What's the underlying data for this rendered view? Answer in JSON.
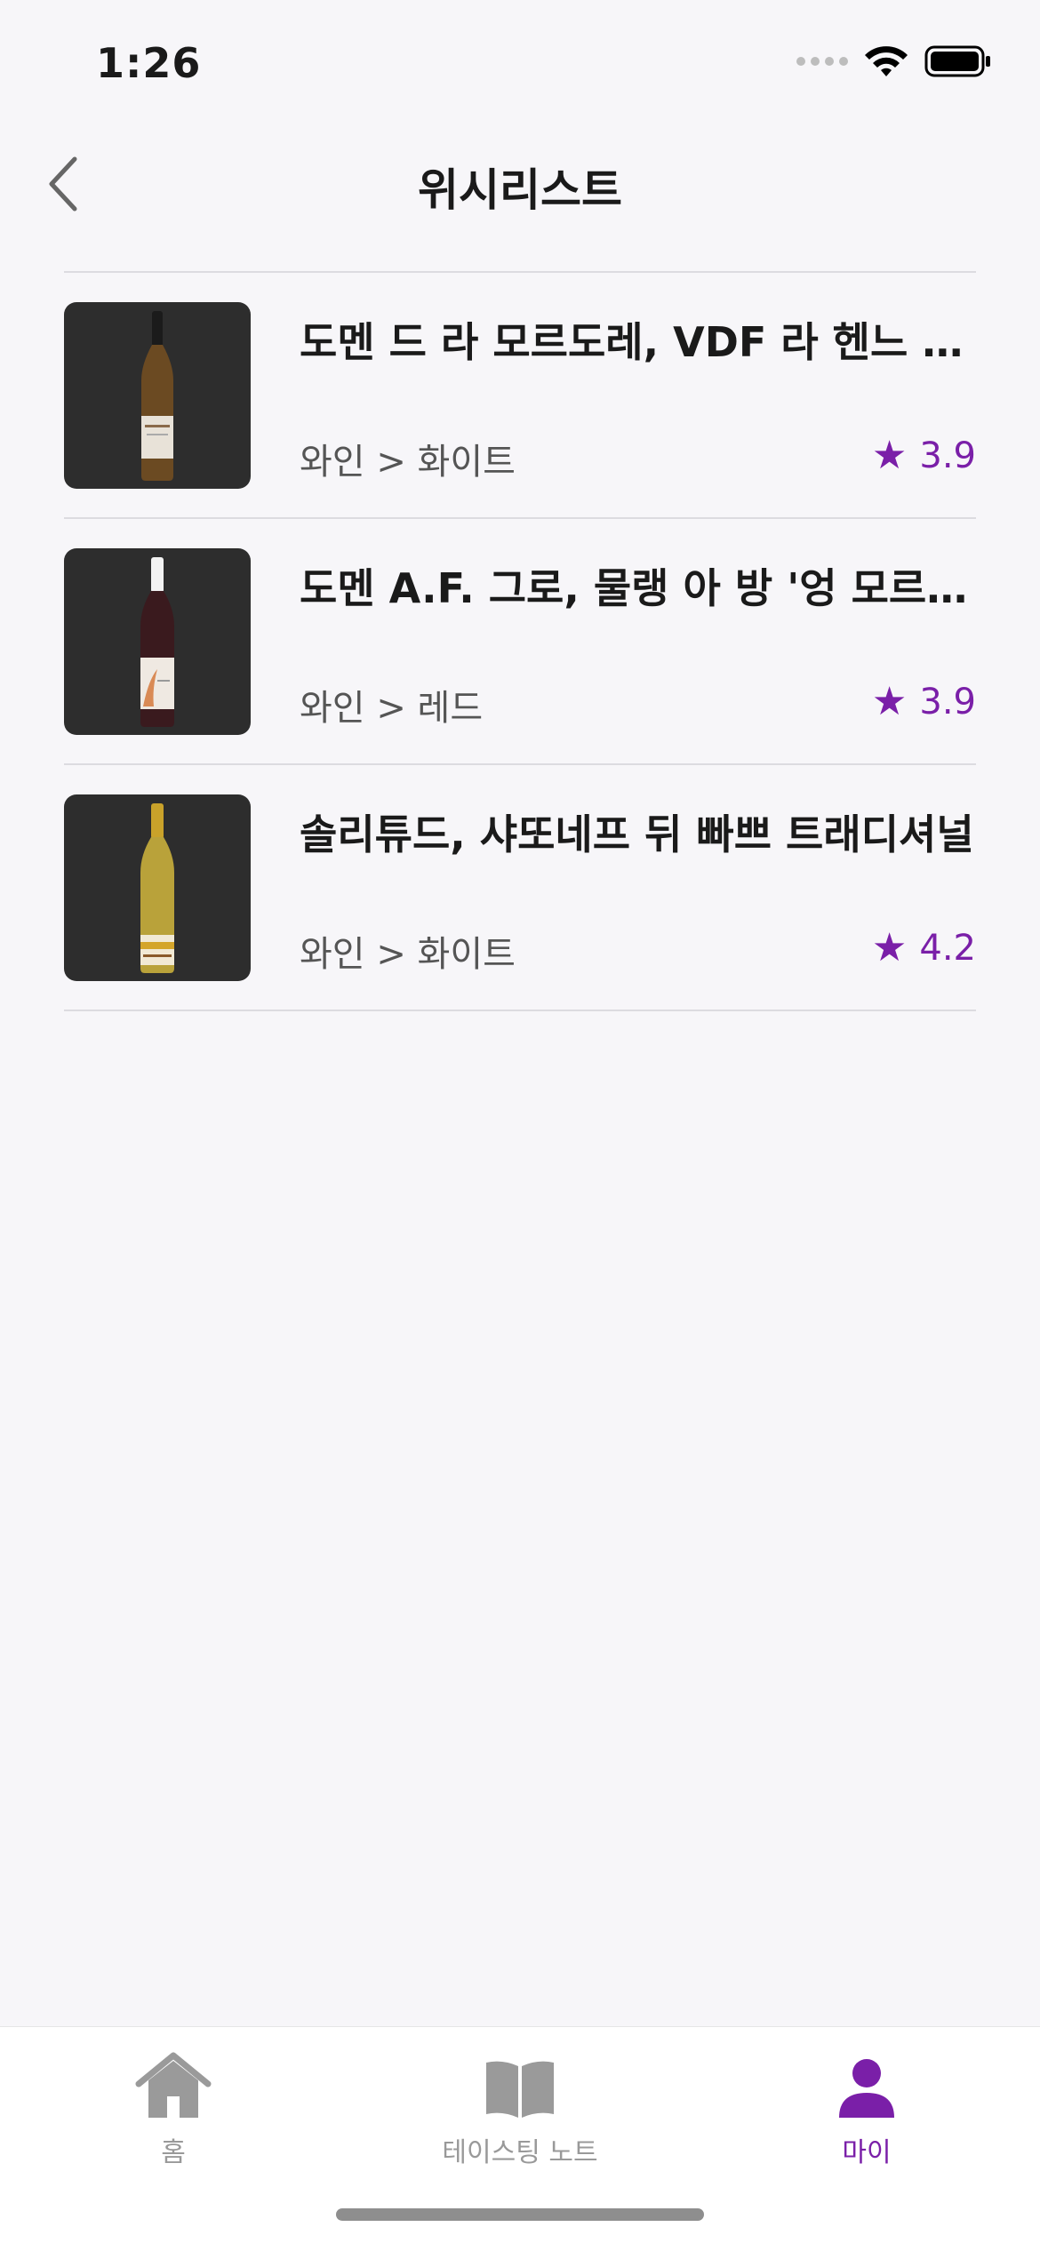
{
  "status_bar": {
    "time": "1:26"
  },
  "nav": {
    "title": "위시리스트",
    "back_icon": "chevron-left-icon"
  },
  "colors": {
    "accent": "#7a1fa8",
    "background": "#f7f6f9",
    "thumb_bg": "#2d2d2d"
  },
  "wishlist": [
    {
      "title": "도멘 드 라 모르도레, VDF 라 헨느 드 플뢰르",
      "category": "와인 > 화이트",
      "rating": "3.9",
      "bottle": "white"
    },
    {
      "title": "도멘 A.F. 그로, 물랭 아 방 '엉 모르페이'",
      "category": "와인 > 레드",
      "rating": "3.9",
      "bottle": "red"
    },
    {
      "title": "솔리튜드, 샤또네프 뒤 빠쁘 트래디셔널",
      "category": "와인 > 화이트",
      "rating": "4.2",
      "bottle": "gold"
    }
  ],
  "tabs": [
    {
      "label": "홈",
      "icon": "home-icon",
      "active": false
    },
    {
      "label": "테이스팅 노트",
      "icon": "book-icon",
      "active": false
    },
    {
      "label": "마이",
      "icon": "person-icon",
      "active": true
    }
  ]
}
